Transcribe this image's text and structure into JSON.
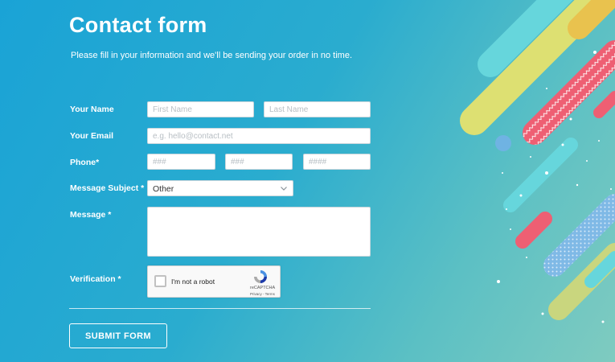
{
  "form": {
    "title": "Contact form",
    "subtitle": "Please fill in your information and we'll be sending your order in no time."
  },
  "fields": {
    "name": {
      "label": "Your Name",
      "first_placeholder": "First Name",
      "last_placeholder": "Last Name"
    },
    "email": {
      "label": "Your Email",
      "placeholder": "e.g. hello@contact.net"
    },
    "phone": {
      "label": "Phone*",
      "part1_placeholder": "###",
      "part2_placeholder": "###",
      "part3_placeholder": "####"
    },
    "subject": {
      "label": "Message Subject *",
      "selected": "Other"
    },
    "message": {
      "label": "Message *"
    },
    "verification": {
      "label": "Verification *",
      "checkbox_text": "I'm not a robot",
      "brand": "reCAPTCHA",
      "links": "Privacy - Terms"
    }
  },
  "actions": {
    "submit_label": "SUBMIT FORM"
  },
  "icons": {
    "dropdown": "chevron-down-icon",
    "captcha": "recaptcha-logo-icon"
  },
  "colors": {
    "background_start": "#1aa3d6",
    "background_end": "#7fcbc0",
    "captcha_blue": "#4a90e2"
  }
}
